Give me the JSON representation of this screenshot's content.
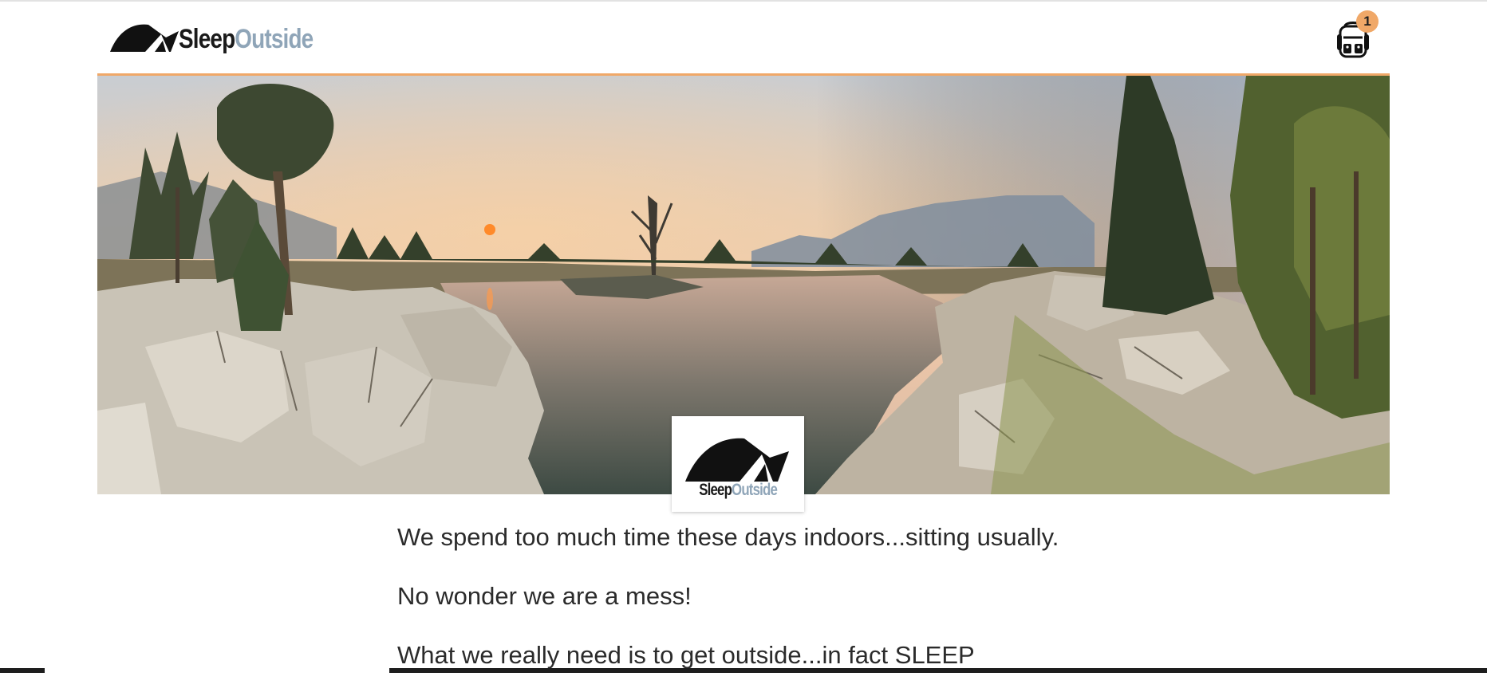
{
  "header": {
    "logo": {
      "part1": "Sleep",
      "part2": "Outside"
    },
    "cart": {
      "icon": "backpack-icon",
      "count": "1"
    }
  },
  "hero": {
    "image": "mountain-lake-sunset",
    "logo": {
      "part1": "Sleep",
      "part2": "Outside"
    }
  },
  "content": {
    "paragraphs": [
      "We spend too much time these days indoors...sitting usually.",
      "No wonder we are a mess!",
      "What we really need is to get outside...in fact SLEEP"
    ]
  },
  "colors": {
    "accent": "#f0a868",
    "logo_dark": "#1a1a1a",
    "logo_light": "#8fa5b8"
  }
}
